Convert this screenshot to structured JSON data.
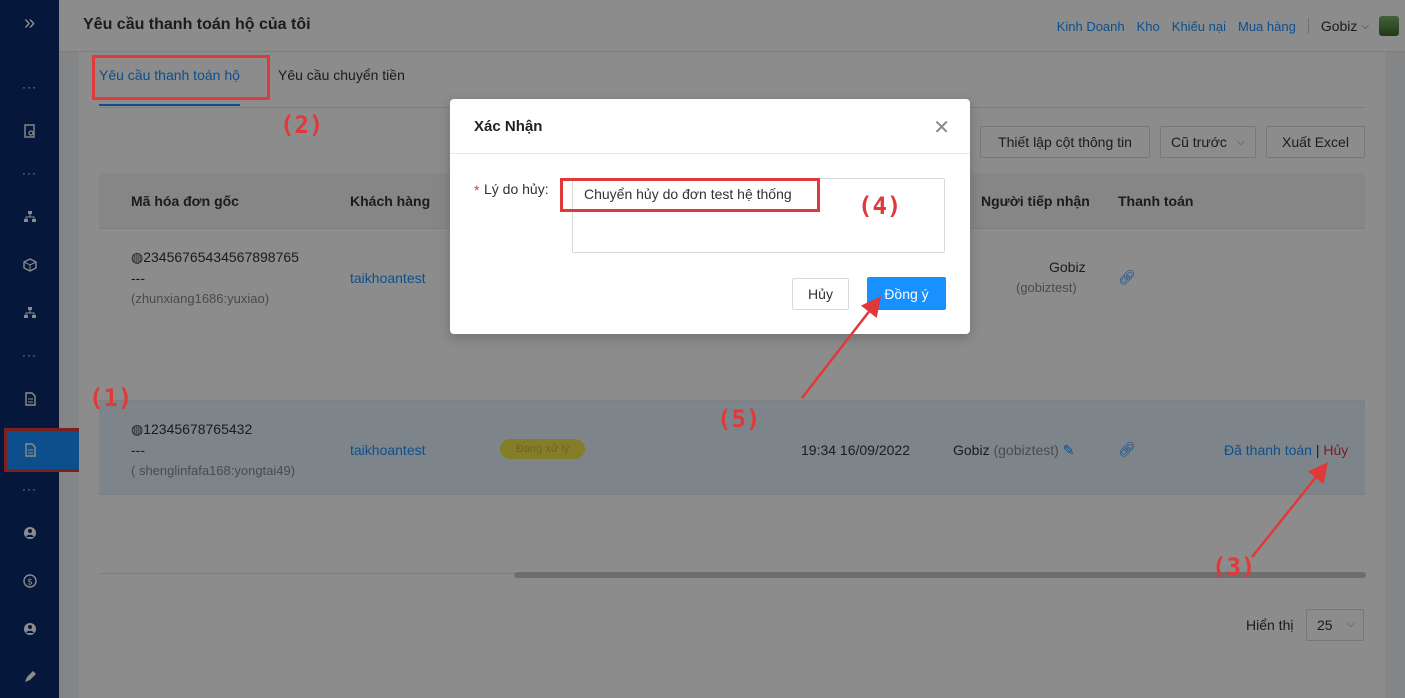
{
  "header": {
    "title": "Yêu cầu thanh toán hộ của tôi",
    "nav": [
      "Kinh Doanh",
      "Kho",
      "Khiếu nại",
      "Mua hàng"
    ],
    "user": "Gobiz"
  },
  "tabs": [
    {
      "label": "Yêu cầu thanh toán hộ"
    },
    {
      "label": "Yêu cầu chuyển tiền"
    }
  ],
  "toolbar": {
    "columns_label": "Thiết lập cột thông tin",
    "sort_label": "Cũ trước",
    "export_label": "Xuất Excel"
  },
  "table": {
    "headers": {
      "invoice": "Mã hóa đơn gốc",
      "customer": "Khách hàng",
      "receiver": "Người tiếp nhận",
      "payment": "Thanh toán"
    },
    "rows": [
      {
        "invoice": "23456765434567898765",
        "dash": "---",
        "account": "(zhunxiang1686:yuxiao)",
        "customer": "taikhoantest",
        "receiver_name": "Gobiz",
        "receiver_user": "(gobiztest)"
      },
      {
        "invoice": "12345678765432",
        "dash": "---",
        "account": "( shenglinfafa168:yongtai49)",
        "customer": "taikhoantest",
        "status": "Đang xử lý",
        "time": "19:34 16/09/2022",
        "receiver_name": "Gobiz",
        "receiver_user": "(gobiztest)",
        "paid_label": "Đã thanh toán",
        "action_sep": "|",
        "cancel_label": "Hủy"
      }
    ]
  },
  "pagination": {
    "label": "Hiển thị",
    "page_size": "25"
  },
  "modal": {
    "title": "Xác Nhận",
    "required_mark": "*",
    "reason_label": "Lý do hủy:",
    "reason_value": "Chuyển hủy do đơn test hệ thống",
    "cancel_button": "Hủy",
    "ok_button": "Đồng ý"
  },
  "annotations": [
    "(1)",
    "(2)",
    "(3)",
    "(4)",
    "(5)"
  ],
  "colors": {
    "sidebar": "#0a2a6b",
    "accent": "#1890ff",
    "annotation": "#e0393a",
    "danger": "#e0393a"
  }
}
